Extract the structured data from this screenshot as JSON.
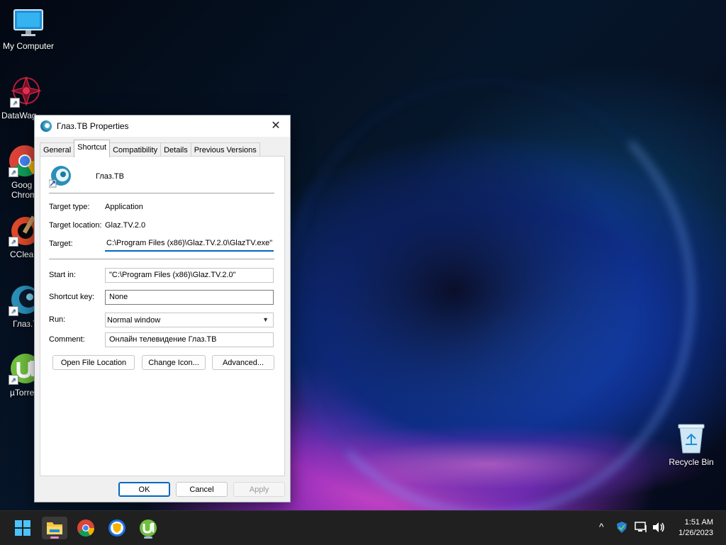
{
  "desktop": {
    "icons": [
      {
        "label": "My Computer"
      },
      {
        "label": "DataWag"
      },
      {
        "label": "Goog\nChrom"
      },
      {
        "label": "CCleaı"
      },
      {
        "label": "Глаз.T"
      },
      {
        "label": "µTorre"
      }
    ],
    "recycle_bin": "Recycle Bin"
  },
  "dialog": {
    "title": "Глаз.ТВ Properties",
    "close_glyph": "✕",
    "tabs": [
      "General",
      "Shortcut",
      "Compatibility",
      "Details",
      "Previous Versions"
    ],
    "active_tab": "Shortcut",
    "app_name": "Глаз.ТВ",
    "fields": {
      "target_type_label": "Target type:",
      "target_type_value": "Application",
      "target_location_label": "Target location:",
      "target_location_value": "Glaz.TV.2.0",
      "target_label": "Target:",
      "target_value": "C:\\Program Files (x86)\\Glaz.TV.2.0\\GlazTV.exe\"",
      "start_in_label": "Start in:",
      "start_in_value": "\"C:\\Program Files (x86)\\Glaz.TV.2.0\"",
      "shortcut_key_label": "Shortcut key:",
      "shortcut_key_value": "None",
      "run_label": "Run:",
      "run_value": "Normal window",
      "comment_label": "Comment:",
      "comment_value": "Онлайн телевидение Глаз.ТВ"
    },
    "buttons": {
      "open_file_location": "Open File Location",
      "change_icon": "Change Icon...",
      "advanced": "Advanced...",
      "ok": "OK",
      "cancel": "Cancel",
      "apply": "Apply"
    }
  },
  "taskbar": {
    "apps": [
      "start",
      "file-explorer",
      "chrome",
      "browser-shield",
      "utorrent"
    ],
    "tray_chevron": "^",
    "clock_time": "1:51 AM",
    "clock_date": "1/26/2023"
  }
}
